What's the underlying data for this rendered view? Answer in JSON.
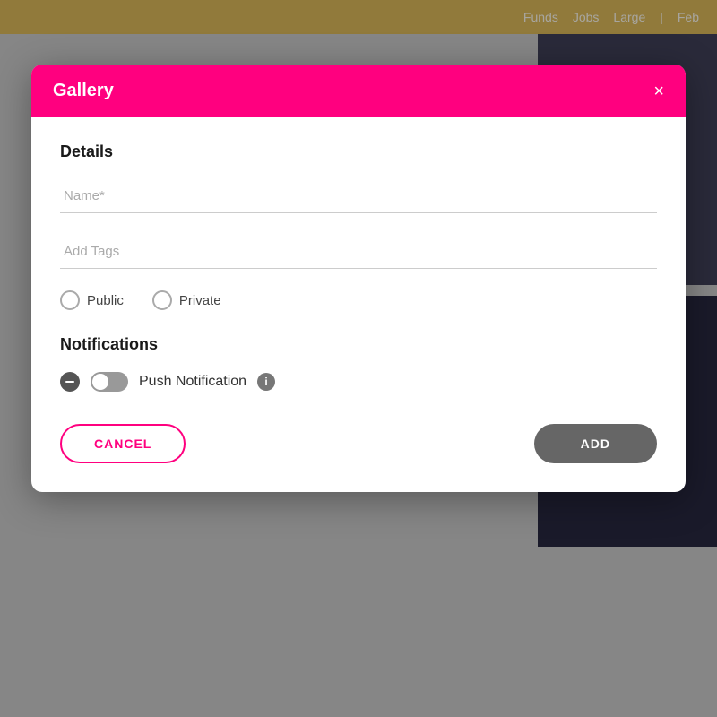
{
  "topbar": {
    "items": [
      "Funds",
      "Jobs",
      "Large",
      "|",
      "Feb"
    ]
  },
  "modal": {
    "title": "Gallery",
    "close_label": "×",
    "details_section": {
      "heading": "Details",
      "name_placeholder": "Name*",
      "tags_placeholder": "Add Tags",
      "visibility": {
        "options": [
          "Public",
          "Private"
        ]
      }
    },
    "notifications_section": {
      "heading": "Notifications",
      "push_notification_label": "Push Notification",
      "info_icon_label": "i"
    },
    "buttons": {
      "cancel_label": "CANCEL",
      "add_label": "ADD"
    }
  }
}
